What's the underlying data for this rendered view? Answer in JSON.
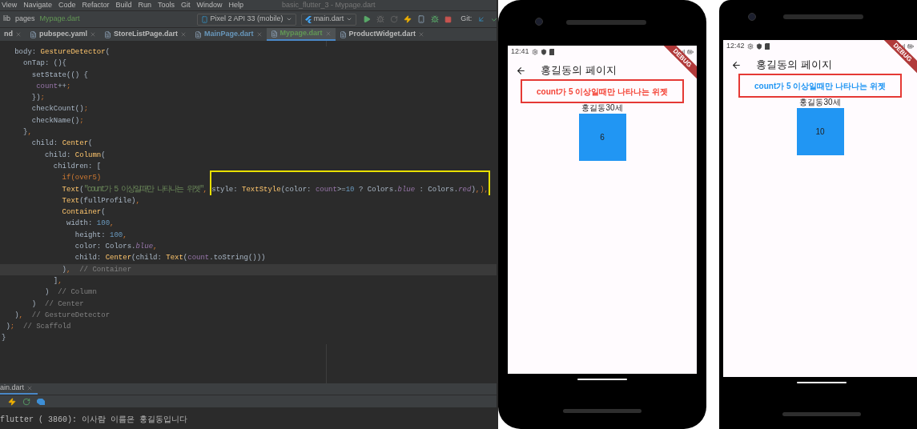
{
  "ide": {
    "menu": [
      "View",
      "Navigate",
      "Code",
      "Refactor",
      "Build",
      "Run",
      "Tools",
      "Git",
      "Window",
      "Help"
    ],
    "title": "basic_flutter_3 - Mypage.dart",
    "breadcrumb": [
      "lib",
      "pages",
      "Mypage.dart"
    ],
    "device": "Pixel 2 API 33 (mobile)",
    "run_config": "main.dart",
    "git_label": "Git:",
    "tabs": [
      {
        "label": "nd",
        "selected": false,
        "color": "#bbbbbb"
      },
      {
        "label": "pubspec.yaml",
        "selected": false,
        "color": "#bbbbbb"
      },
      {
        "label": "StoreListPage.dart",
        "selected": false,
        "color": "#bbbbbb"
      },
      {
        "label": "MainPage.dart",
        "selected": false,
        "color": "#6897bb"
      },
      {
        "label": "Mypage.dart",
        "selected": true,
        "color": "#629755"
      },
      {
        "label": "ProductWidget.dart",
        "selected": false,
        "color": "#bbbbbb"
      }
    ],
    "code": [
      {
        "current": false,
        "tokens": [
          {
            "kind": "p",
            "text": "   body: "
          },
          {
            "kind": "cls",
            "text": "GestureDetector"
          },
          {
            "kind": "p",
            "text": "("
          }
        ]
      },
      {
        "current": false,
        "tokens": [
          {
            "kind": "p",
            "text": "     onTap: (){"
          }
        ]
      },
      {
        "current": false,
        "tokens": [
          {
            "kind": "p",
            "text": "       setState(() {"
          }
        ]
      },
      {
        "current": false,
        "tokens": [
          {
            "kind": "field",
            "text": "        count"
          },
          {
            "kind": "p",
            "text": "++"
          },
          {
            "kind": "kw",
            "text": ";"
          }
        ]
      },
      {
        "current": false,
        "tokens": [
          {
            "kind": "p",
            "text": "       })"
          },
          {
            "kind": "kw",
            "text": ";"
          }
        ]
      },
      {
        "current": false,
        "tokens": [
          {
            "kind": "p",
            "text": "       checkCount()"
          },
          {
            "kind": "kw",
            "text": ";"
          }
        ]
      },
      {
        "current": false,
        "tokens": [
          {
            "kind": "p",
            "text": "       checkName()"
          },
          {
            "kind": "kw",
            "text": ";"
          }
        ]
      },
      {
        "current": false,
        "tokens": [
          {
            "kind": "p",
            "text": "     }"
          },
          {
            "kind": "kw",
            "text": ","
          }
        ]
      },
      {
        "current": false,
        "tokens": [
          {
            "kind": "p",
            "text": "       child: "
          },
          {
            "kind": "cls",
            "text": "Center"
          },
          {
            "kind": "p",
            "text": "("
          }
        ]
      },
      {
        "current": false,
        "tokens": [
          {
            "kind": "p",
            "text": "          child: "
          },
          {
            "kind": "cls",
            "text": "Column"
          },
          {
            "kind": "p",
            "text": "("
          }
        ]
      },
      {
        "current": false,
        "tokens": [
          {
            "kind": "p",
            "text": "            children: ["
          }
        ]
      },
      {
        "current": false,
        "tokens": [
          {
            "kind": "kw",
            "text": "              if(over5)"
          }
        ]
      },
      {
        "current": false,
        "tokens": [
          {
            "kind": "cls",
            "text": "              Text"
          },
          {
            "kind": "p",
            "text": "("
          },
          {
            "kind": "str",
            "text": "\"count가 5 이상일때만 나타나는 위젯\""
          },
          {
            "kind": "kw",
            "text": ", "
          }
        ],
        "boxed": [
          {
            "kind": "p",
            "text": "style: "
          },
          {
            "kind": "cls",
            "text": "TextStyle"
          },
          {
            "kind": "p",
            "text": "(color: "
          },
          {
            "kind": "field",
            "text": "count"
          },
          {
            "kind": "p",
            "text": ">="
          },
          {
            "kind": "num",
            "text": "10"
          },
          {
            "kind": "p",
            "text": " ? Colors."
          },
          {
            "kind": "static",
            "text": "blue"
          },
          {
            "kind": "p",
            "text": " : Colors."
          },
          {
            "kind": "static",
            "text": "red"
          },
          {
            "kind": "p",
            "text": ")"
          },
          {
            "kind": "kw",
            "text": ",),"
          }
        ]
      },
      {
        "current": false,
        "tokens": [
          {
            "kind": "cls",
            "text": "              Text"
          },
          {
            "kind": "p",
            "text": "(fullProfile)"
          },
          {
            "kind": "kw",
            "text": ","
          }
        ]
      },
      {
        "current": false,
        "tokens": [
          {
            "kind": "cls",
            "text": "              Container"
          },
          {
            "kind": "p",
            "text": "("
          }
        ]
      },
      {
        "current": false,
        "tokens": [
          {
            "kind": "p",
            "text": "               width: "
          },
          {
            "kind": "num",
            "text": "100"
          },
          {
            "kind": "kw",
            "text": ","
          }
        ]
      },
      {
        "current": false,
        "tokens": [
          {
            "kind": "p",
            "text": "                 height: "
          },
          {
            "kind": "num",
            "text": "100"
          },
          {
            "kind": "kw",
            "text": ","
          }
        ]
      },
      {
        "current": false,
        "tokens": [
          {
            "kind": "p",
            "text": "                 color: Colors."
          },
          {
            "kind": "static",
            "text": "blue"
          },
          {
            "kind": "kw",
            "text": ","
          }
        ]
      },
      {
        "current": false,
        "tokens": [
          {
            "kind": "p",
            "text": "                 child: "
          },
          {
            "kind": "cls",
            "text": "Center"
          },
          {
            "kind": "p",
            "text": "(child: "
          },
          {
            "kind": "cls",
            "text": "Text"
          },
          {
            "kind": "p",
            "text": "("
          },
          {
            "kind": "field",
            "text": "count"
          },
          {
            "kind": "p",
            "text": ".toString()))"
          }
        ]
      },
      {
        "current": true,
        "tokens": [
          {
            "kind": "p",
            "text": "              )"
          },
          {
            "kind": "kw",
            "text": ","
          },
          {
            "kind": "cmt",
            "text": "  // Container"
          }
        ]
      },
      {
        "current": false,
        "tokens": [
          {
            "kind": "p",
            "text": "            ]"
          },
          {
            "kind": "kw",
            "text": ","
          }
        ]
      },
      {
        "current": false,
        "tokens": [
          {
            "kind": "p",
            "text": "          )"
          },
          {
            "kind": "cmt",
            "text": "  // Column"
          }
        ]
      },
      {
        "current": false,
        "tokens": [
          {
            "kind": "p",
            "text": "       )"
          },
          {
            "kind": "cmt",
            "text": "  // Center"
          }
        ]
      },
      {
        "current": false,
        "tokens": [
          {
            "kind": "p",
            "text": "   )"
          },
          {
            "kind": "kw",
            "text": ","
          },
          {
            "kind": "cmt",
            "text": "  // GestureDetector"
          }
        ]
      },
      {
        "current": false,
        "tokens": [
          {
            "kind": "p",
            "text": " )"
          },
          {
            "kind": "kw",
            "text": ";"
          },
          {
            "kind": "cmt",
            "text": "  // Scaffold"
          }
        ]
      },
      {
        "current": false,
        "tokens": [
          {
            "kind": "p",
            "text": "}"
          }
        ]
      }
    ],
    "run_tab": "ain.dart",
    "console": [
      "flutter ( 3860): 이사람 이름은 홍길동입니다"
    ]
  },
  "phones": [
    {
      "time": "12:41",
      "banner": "DEBUG",
      "title": "홍길동의 페이지",
      "message": {
        "text": "count가 5 이상일때만 나타나는 위젯",
        "color": "#f44336"
      },
      "profile": "홍길동30세",
      "count": "6"
    },
    {
      "time": "12:42",
      "banner": "DEBUG",
      "title": "홍길동의 페이지",
      "message": {
        "text": "count가 5 이상일때만 나타나는 위젯",
        "color": "#2196f3"
      },
      "profile": "홍길동30세",
      "count": "10"
    }
  ]
}
